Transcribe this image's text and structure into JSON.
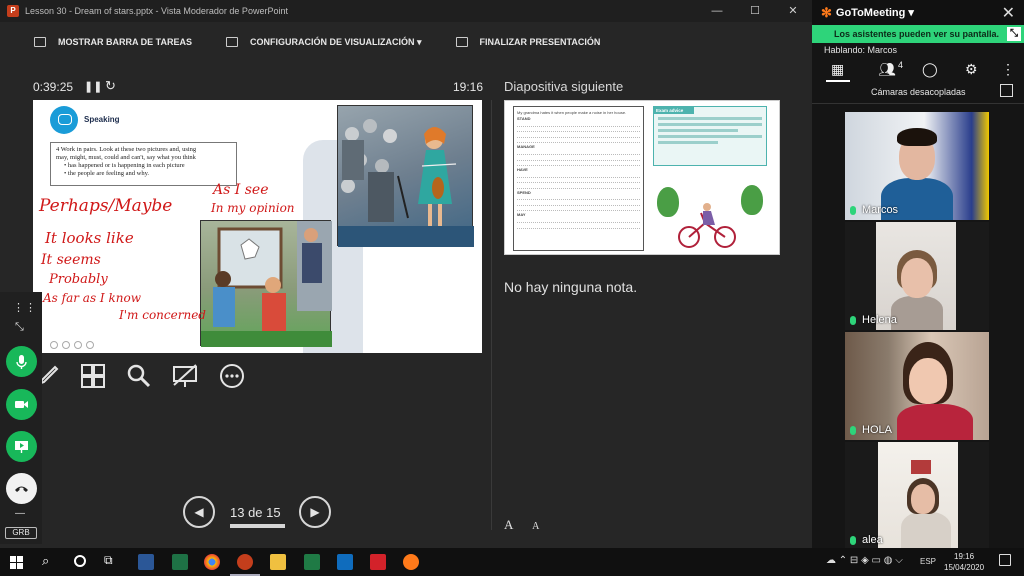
{
  "window": {
    "title": "Lesson 30 - Dream of stars.pptx - Vista Moderador de PowerPoint",
    "controls": [
      "—",
      "☐",
      "✕"
    ]
  },
  "toolbar": {
    "taskbar_label": "MOSTRAR BARRA DE TAREAS",
    "display_settings_label": "CONFIGURACIÓN DE VISUALIZACIÓN ▾",
    "end_show_label": "FINALIZAR PRESENTACIÓN"
  },
  "presenter": {
    "elapsed": "0:39:25",
    "clock": "19:16",
    "next_slide_label": "Diapositiva siguiente",
    "notes": "No hay ninguna nota.",
    "slide_counter": "13 de 15",
    "font_increase": "A",
    "font_decrease": "A"
  },
  "slide": {
    "heading": "Speaking",
    "instruction_line1": "4  Work in pairs. Look at these two pictures and, using",
    "instruction_line2": "may, might, must, could and can't, say what you think",
    "bullet1": "• has happened or is happening in each picture",
    "bullet2": "• the people are feeling and why.",
    "ink": {
      "perhaps": "Perhaps/Maybe",
      "looks_like": "It looks like",
      "seems": "It seems",
      "probably": "Probably",
      "as_far": "As far as I know",
      "concerned": "I'm concerned",
      "as_i_see": "As I see",
      "in_my_opinion": "In my opinion"
    }
  },
  "next_slide": {
    "exam_advice": "Exam advice",
    "line1": "My grandma hates it when people make a noise in her house.",
    "line2": "STAND",
    "line3": "MANAGE",
    "line4": "HAVE",
    "line5": "SPEND",
    "line6": "MAY"
  },
  "gotomeeting": {
    "brand": "GoToMeeting ▾",
    "banner": "Los asistentes pueden ver su pantalla.",
    "speaking": "Hablando: Marcos",
    "attendee_count": "4",
    "cams": "Cámaras desacopladas",
    "participants": [
      {
        "name": "Marcos"
      },
      {
        "name": "Helena"
      },
      {
        "name": "HOLA"
      },
      {
        "name": "alea"
      }
    ],
    "grb": "GRB"
  },
  "taskbar": {
    "lang": "ESP",
    "time": "19:16",
    "date": "15/04/2020"
  },
  "colors": {
    "accent_green": "#2ed47a",
    "button_green": "#18b85a",
    "ink_red": "#d01818",
    "brand_orange": "#ff7a1a"
  }
}
